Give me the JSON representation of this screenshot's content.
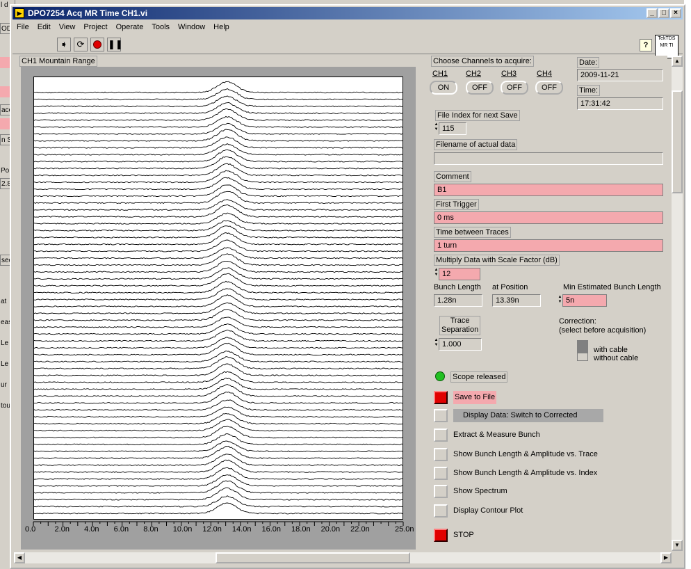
{
  "background_window": {
    "fragments": [
      "l d",
      "OD",
      "",
      "",
      "ace",
      "",
      "n S",
      "Po",
      "2.8",
      "sec",
      "at",
      "eas",
      "Le",
      "Le",
      "ur",
      "tou"
    ]
  },
  "window": {
    "title": "DPO7254 Acq MR Time CH1.vi",
    "controls": {
      "minimize": "_",
      "maximize": "□",
      "close": "×"
    },
    "menu": [
      "File",
      "Edit",
      "View",
      "Project",
      "Operate",
      "Tools",
      "Window",
      "Help"
    ],
    "help_label": "?",
    "tek_icon_text": "TekTDS MR TI"
  },
  "toolbar": {
    "icons": [
      "run-arrow-icon",
      "run-continuously-icon",
      "abort-icon",
      "pause-icon"
    ]
  },
  "plot": {
    "label": "CH1 Mountain Range",
    "x_ticks": [
      "0.0",
      "2.0n",
      "4.0n",
      "6.0n",
      "8.0n",
      "10.0n",
      "12.0n",
      "14.0n",
      "16.0n",
      "18.0n",
      "20.0n",
      "22.0n",
      "25.0n"
    ]
  },
  "chart_data": {
    "type": "line",
    "title": "CH1 Mountain Range",
    "xlabel": "",
    "ylabel": "",
    "x_range": [
      0,
      2.5e-08
    ],
    "trace_count": 62,
    "peak_position_ns": 13.1,
    "peak_width_ns": 1.28,
    "grid": false
  },
  "channels": {
    "label": "Choose Channels to acquire:",
    "items": [
      {
        "name": "CH1",
        "state": "ON"
      },
      {
        "name": "CH2",
        "state": "OFF"
      },
      {
        "name": "CH3",
        "state": "OFF"
      },
      {
        "name": "CH4",
        "state": "OFF"
      }
    ]
  },
  "date": {
    "label": "Date:",
    "value": "2009-11-21"
  },
  "time": {
    "label": "Time:",
    "value": "17:31:42"
  },
  "file_index": {
    "label": "File Index for next Save",
    "value": "115"
  },
  "filename": {
    "label": "Filename of actual data",
    "value": ""
  },
  "comment": {
    "label": "Comment",
    "value": "B1"
  },
  "first_trigger": {
    "label": "First Trigger",
    "value": "0 ms"
  },
  "time_between": {
    "label": "Time between Traces",
    "value": "1 turn"
  },
  "scale_factor": {
    "label": "Multiply Data with Scale Factor (dB)",
    "value": "12"
  },
  "bunch_length": {
    "label": "Bunch Length",
    "value": "1.28n"
  },
  "at_position": {
    "label": "at Position",
    "value": "13.39n"
  },
  "min_bunch": {
    "label": "Min Estimated Bunch Length",
    "value": "5n"
  },
  "trace_sep": {
    "label_line1": "Trace",
    "label_line2": "Separation",
    "value": "1.000"
  },
  "correction": {
    "label_line1": "Correction:",
    "label_line2": "(select before acquisition)",
    "opt1": "with cable",
    "opt2": "without cable"
  },
  "scope_status": {
    "label": "Scope released",
    "led_color": "#22c022"
  },
  "buttons": {
    "save": "Save to File",
    "display": "Display Data: Switch to Corrected",
    "extract": "Extract & Measure Bunch",
    "show_trace": "Show Bunch Length & Amplitude vs. Trace",
    "show_index": "Show Bunch Length & Amplitude vs. Index",
    "spectrum": "Show Spectrum",
    "contour": "Display Contour Plot",
    "stop": "STOP"
  },
  "colors": {
    "control_pink": "#f4a9ae",
    "stop_red": "#e00000",
    "title_blue": "#0a246a"
  }
}
